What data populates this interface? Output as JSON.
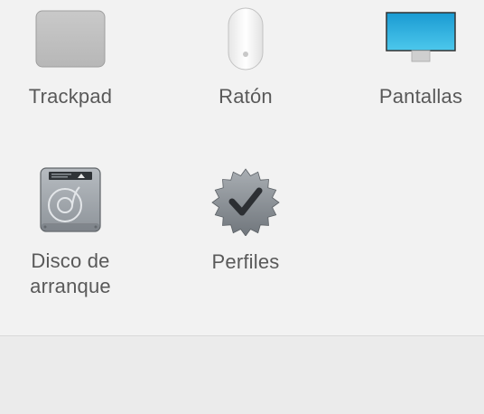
{
  "panes": {
    "trackpad": {
      "label": "Trackpad",
      "icon": "trackpad-icon"
    },
    "mouse": {
      "label": "Ratón",
      "icon": "mouse-icon"
    },
    "displays": {
      "label": "Pantallas",
      "icon": "display-icon"
    },
    "startup_disk": {
      "label": "Disco de\narranque",
      "icon": "hard-drive-icon"
    },
    "profiles": {
      "label": "Perfiles",
      "icon": "verified-badge-icon"
    }
  },
  "colors": {
    "background": "#f2f2f2",
    "footer": "#ebebeb",
    "label_text": "#595959",
    "display_screen": "#2aa8d8"
  }
}
